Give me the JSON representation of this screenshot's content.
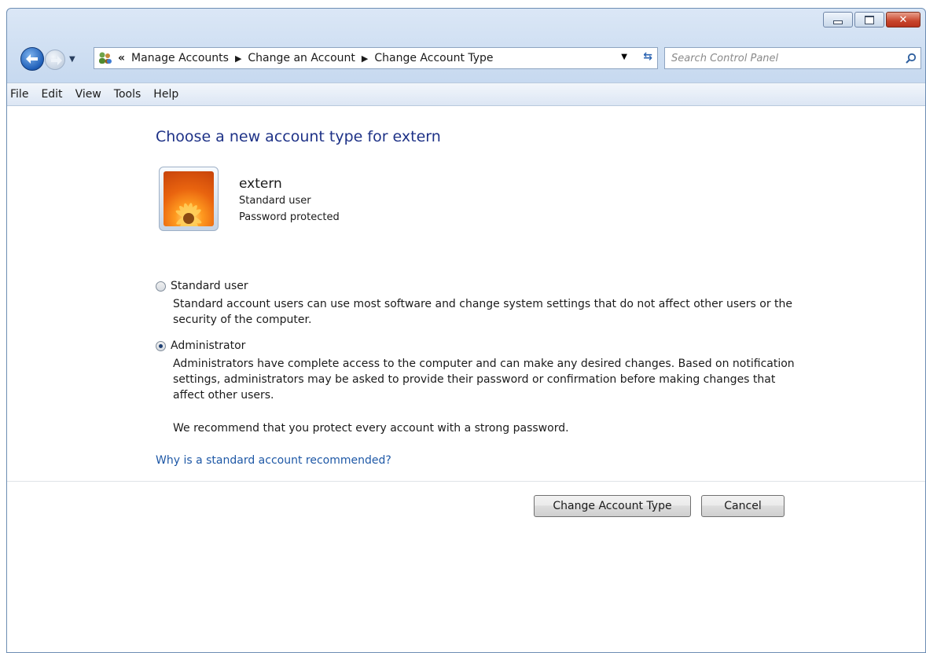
{
  "window": {
    "minimize_icon": "minimize-icon",
    "maximize_icon": "maximize-icon",
    "close_icon": "close-icon"
  },
  "nav": {
    "back_icon": "back-arrow-icon",
    "forward_icon": "forward-arrow-icon",
    "address_icon": "control-panel-users-icon",
    "overflow": "«",
    "breadcrumbs": [
      "Manage Accounts",
      "Change an Account",
      "Change Account Type"
    ],
    "search_placeholder": "Search Control Panel"
  },
  "menu": [
    "File",
    "Edit",
    "View",
    "Tools",
    "Help"
  ],
  "page": {
    "heading": "Choose a new account type for extern",
    "account": {
      "name": "extern",
      "type": "Standard user",
      "status": "Password protected"
    },
    "options": [
      {
        "label": "Standard user",
        "selected": false,
        "description": "Standard account users can use most software and change system settings that do not affect other users or the security of the computer."
      },
      {
        "label": "Administrator",
        "selected": true,
        "description": "Administrators have complete access to the computer and can make any desired changes. Based on notification settings, administrators may be asked to provide their password or confirmation before making changes that affect other users."
      }
    ],
    "recommendation": "We recommend that you protect every account with a strong password.",
    "help_link": "Why is a standard account recommended?",
    "buttons": {
      "confirm": "Change Account Type",
      "cancel": "Cancel"
    }
  }
}
